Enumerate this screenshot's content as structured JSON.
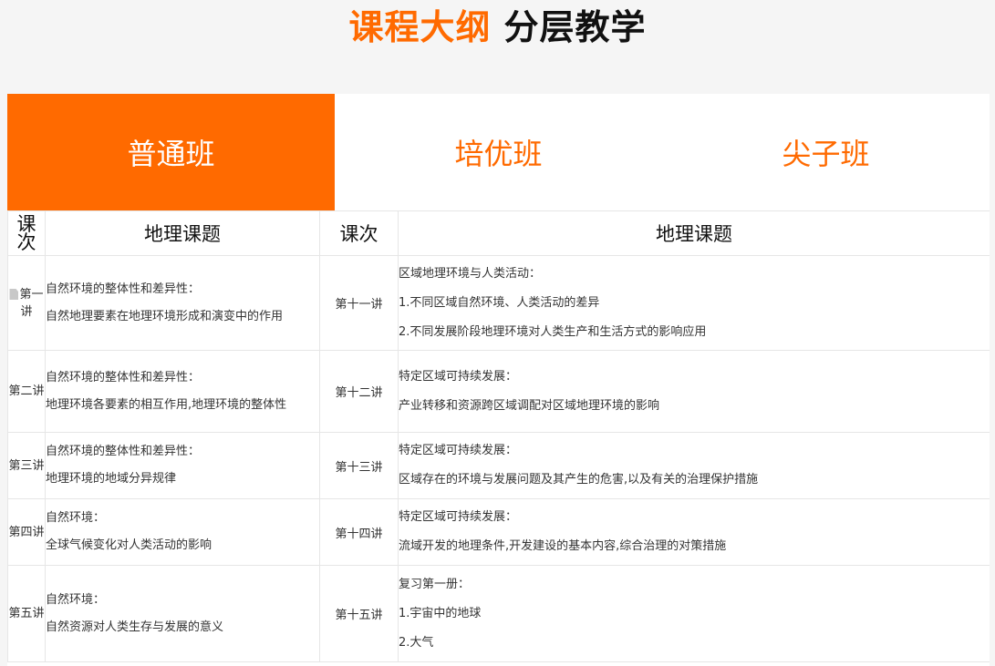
{
  "heading": {
    "accent": "课程大纲",
    "rest": "分层教学"
  },
  "tabs": [
    {
      "label": "普通班",
      "active": true
    },
    {
      "label": "培优班",
      "active": false
    },
    {
      "label": "尖子班",
      "active": false
    }
  ],
  "table": {
    "headers": {
      "lesson_left": "课次",
      "topic_left": "地理课题",
      "lesson_right": "课次",
      "topic_right": "地理课题"
    },
    "rows": [
      {
        "left_lesson": "第一讲",
        "left_topic": [
          "自然环境的整体性和差异性：",
          "自然地理要素在地理环境形成和演变中的作用"
        ],
        "right_lesson": "第十一讲",
        "right_topic": [
          "区域地理环境与人类活动：",
          "1.不同区域自然环境、人类活动的差异",
          "2.不同发展阶段地理环境对人类生产和生活方式的影响应用"
        ]
      },
      {
        "left_lesson": "第二讲",
        "left_topic": [
          "自然环境的整体性和差异性：",
          "地理环境各要素的相互作用,地理环境的整体性"
        ],
        "right_lesson": "第十二讲",
        "right_topic": [
          "特定区域可持续发展：",
          "产业转移和资源跨区域调配对区域地理环境的影响"
        ]
      },
      {
        "left_lesson": "第三讲",
        "left_topic": [
          "自然环境的整体性和差异性：",
          "地理环境的地域分异规律"
        ],
        "right_lesson": "第十三讲",
        "right_topic": [
          "特定区域可持续发展：",
          "区域存在的环境与发展问题及其产生的危害,以及有关的治理保护措施"
        ]
      },
      {
        "left_lesson": "第四讲",
        "left_topic": [
          "自然环境：",
          "全球气候变化对人类活动的影响"
        ],
        "right_lesson": "第十四讲",
        "right_topic": [
          "特定区域可持续发展：",
          "流域开发的地理条件,开发建设的基本内容,综合治理的对策措施"
        ]
      },
      {
        "left_lesson": "第五讲",
        "left_topic": [
          "自然环境：",
          "自然资源对人类生存与发展的意义"
        ],
        "right_lesson": "第十五讲",
        "right_topic": [
          "复习第一册：",
          "1.宇宙中的地球",
          "2.大气"
        ]
      }
    ]
  },
  "colors": {
    "accent": "#ff6a00",
    "border": "#e6e6e6",
    "background": "#f5f5f5"
  }
}
